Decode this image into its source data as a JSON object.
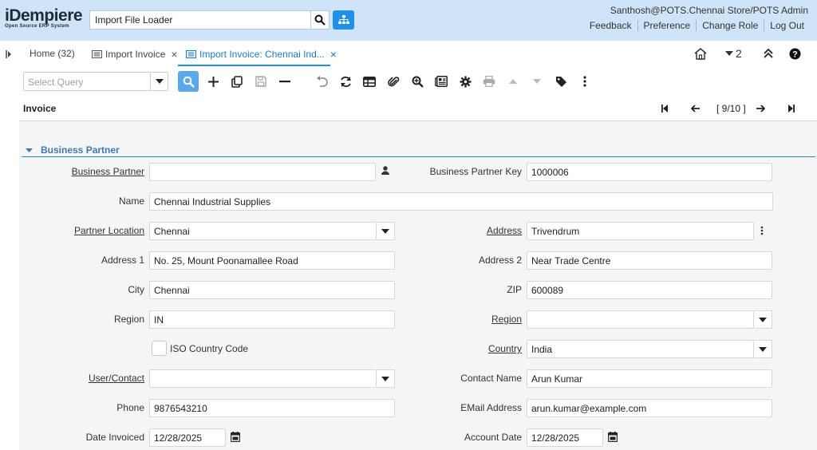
{
  "header": {
    "logo_main": "iDempiere",
    "logo_sub": "Open Source ERP System",
    "search_value": "Import File Loader",
    "user": "Santhosh@POTS.Chennai Store/POTS Admin",
    "links": [
      "Feedback",
      "Preference",
      "Change Role",
      "Log Out"
    ]
  },
  "tabs": [
    {
      "label": "Home (32)"
    },
    {
      "label": "Import Invoice"
    },
    {
      "label": "Import Invoice: Chennai Ind..."
    }
  ],
  "tab_right": {
    "count": "2"
  },
  "toolbar": {
    "query_placeholder": "Select Query"
  },
  "breadcrumb": {
    "title": "Invoice",
    "record": "[ 9/10 ]"
  },
  "group": {
    "title": "Business Partner"
  },
  "fields": {
    "business_partner": {
      "label": "Business Partner",
      "value": ""
    },
    "business_partner_key": {
      "label": "Business Partner Key",
      "value": "1000006"
    },
    "name": {
      "label": "Name",
      "value": "Chennai Industrial Supplies"
    },
    "partner_location": {
      "label": "Partner Location",
      "value": "Chennai"
    },
    "address": {
      "label": "Address",
      "value": "Trivendrum"
    },
    "address1": {
      "label": "Address 1",
      "value": "No. 25, Mount Poonamallee Road"
    },
    "address2": {
      "label": "Address 2",
      "value": "Near Trade Centre"
    },
    "city": {
      "label": "City",
      "value": "Chennai"
    },
    "zip": {
      "label": "ZIP",
      "value": "600089"
    },
    "region_text": {
      "label": "Region",
      "value": "IN"
    },
    "region": {
      "label": "Region",
      "value": ""
    },
    "iso_country_code": {
      "label": "ISO Country Code",
      "checked": false
    },
    "country": {
      "label": "Country",
      "value": "India"
    },
    "user_contact": {
      "label": "User/Contact",
      "value": ""
    },
    "contact_name": {
      "label": "Contact Name",
      "value": "Arun Kumar"
    },
    "phone": {
      "label": "Phone",
      "value": "9876543210"
    },
    "email": {
      "label": "EMail Address",
      "value": "arun.kumar@example.com"
    },
    "date_invoiced": {
      "label": "Date Invoiced",
      "value": "12/28/2025"
    },
    "account_date": {
      "label": "Account Date",
      "value": "12/28/2025"
    }
  }
}
